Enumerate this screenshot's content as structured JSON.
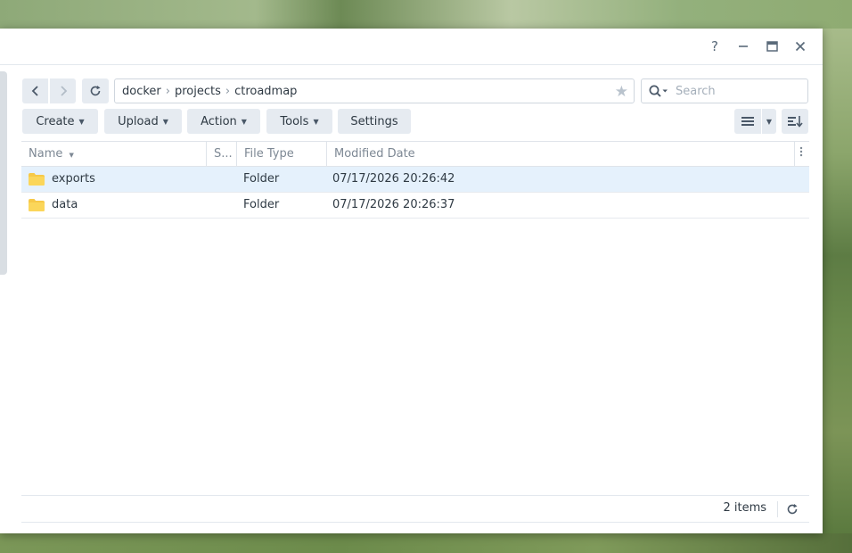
{
  "window": {
    "controls": {
      "help": "?",
      "minimize": "–",
      "maximize": "▭",
      "close": "✕"
    }
  },
  "nav": {
    "back_icon": "chevron-left-icon",
    "forward_icon": "chevron-right-icon",
    "refresh_icon": "refresh-icon",
    "path": [
      "docker",
      "projects",
      "ctroadmap"
    ],
    "separator": "›",
    "search_placeholder": "Search"
  },
  "toolbar": {
    "create": "Create",
    "upload": "Upload",
    "action": "Action",
    "tools": "Tools",
    "settings": "Settings"
  },
  "table": {
    "columns": {
      "name": "Name",
      "size": "S...",
      "type": "File Type",
      "modified": "Modified Date"
    },
    "rows": [
      {
        "name": "exports",
        "type": "Folder",
        "modified": "07/17/2026 20:26:42",
        "selected": true
      },
      {
        "name": "data",
        "type": "Folder",
        "modified": "07/17/2026 20:26:37",
        "selected": false
      }
    ]
  },
  "footer": {
    "count": "2 items"
  },
  "colors": {
    "selected_row": "#e5f1fc",
    "folder": "#f7c948",
    "button_bg": "#e6ebf1"
  }
}
